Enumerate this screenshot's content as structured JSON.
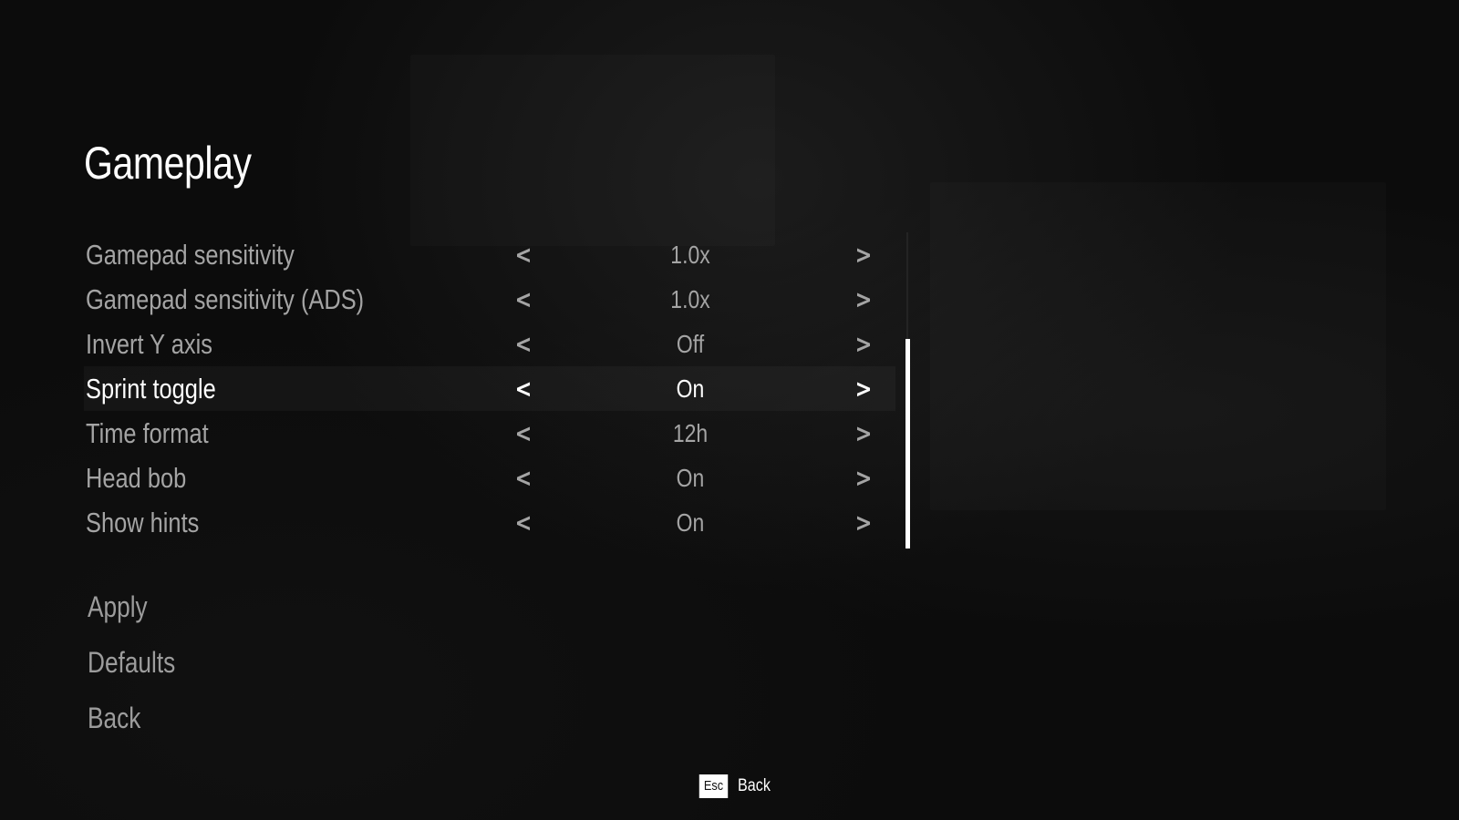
{
  "screen": {
    "title": "Gameplay"
  },
  "settings": [
    {
      "label": "Gamepad sensitivity",
      "value": "1.0x",
      "selected": false
    },
    {
      "label": "Gamepad sensitivity (ADS)",
      "value": "1.0x",
      "selected": false
    },
    {
      "label": "Invert Y axis",
      "value": "Off",
      "selected": false
    },
    {
      "label": "Sprint toggle",
      "value": "On",
      "selected": true
    },
    {
      "label": "Time format",
      "value": "12h",
      "selected": false
    },
    {
      "label": "Head bob",
      "value": "On",
      "selected": false
    },
    {
      "label": "Show hints",
      "value": "On",
      "selected": false
    }
  ],
  "arrows": {
    "left": "<",
    "right": ">"
  },
  "actions": {
    "apply": "Apply",
    "defaults": "Defaults",
    "back": "Back"
  },
  "footer": {
    "key": "Esc",
    "label": "Back"
  },
  "colors": {
    "background": "#0b0b0b",
    "text_dim": "#a4a4a4",
    "text_active": "#ffffff"
  }
}
